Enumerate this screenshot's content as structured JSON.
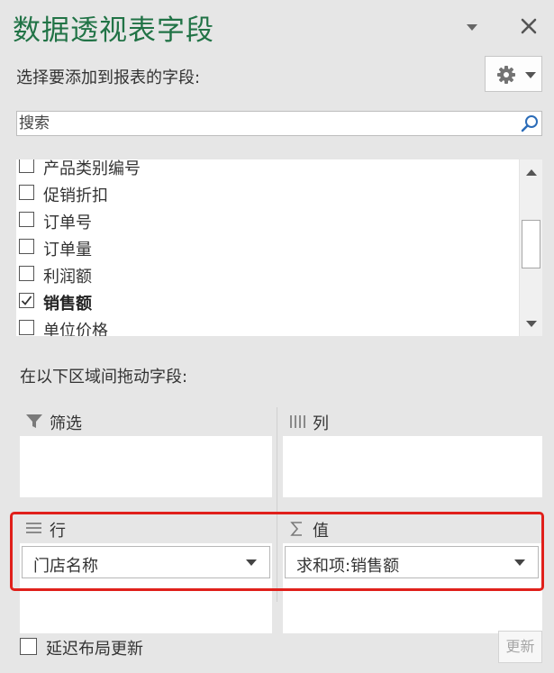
{
  "pane": {
    "title": "数据透视表字段",
    "choose_label": "选择要添加到报表的字段:"
  },
  "icons": {
    "dropdown": "chevron-down-icon",
    "close": "close-icon",
    "settings": "gear-icon",
    "search": "search-icon"
  },
  "search": {
    "placeholder": "搜索"
  },
  "fields": [
    {
      "label": "产品类别编号",
      "checked": false
    },
    {
      "label": "促销折扣",
      "checked": false
    },
    {
      "label": "订单号",
      "checked": false
    },
    {
      "label": "订单量",
      "checked": false
    },
    {
      "label": "利润额",
      "checked": false
    },
    {
      "label": "销售额",
      "checked": true
    },
    {
      "label": "单位价格",
      "checked": false
    }
  ],
  "areas": {
    "drag_label": "在以下区域间拖动字段:",
    "filter": {
      "label": "筛选"
    },
    "columns": {
      "label": "列"
    },
    "rows": {
      "label": "行",
      "item": "门店名称"
    },
    "values": {
      "label": "值",
      "item": "求和项:销售额"
    }
  },
  "footer": {
    "defer_label": "延迟布局更新",
    "defer_checked": false,
    "update_label": "更新"
  },
  "colors": {
    "title": "#217346",
    "highlight": "#e0201b",
    "background": "#e6e6e6"
  }
}
